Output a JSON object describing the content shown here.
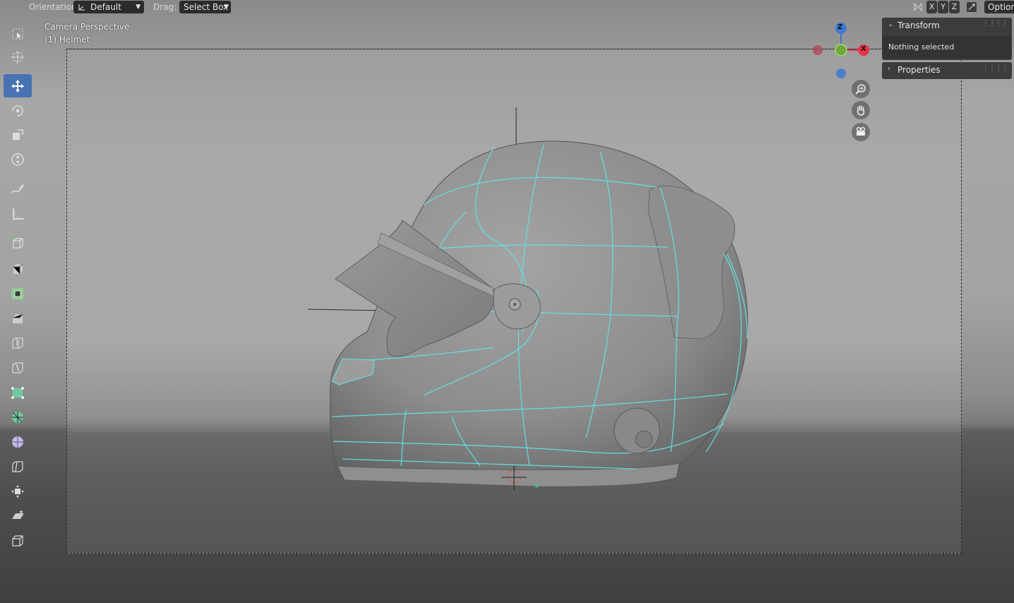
{
  "header": {
    "orientation_label": "Orientation:",
    "orientation_value": "Default",
    "drag_label": "Drag:",
    "drag_value": "Select Box",
    "axis_x": "X",
    "axis_y": "Y",
    "axis_z": "Z",
    "options_label": "Options"
  },
  "viewport": {
    "view_name": "Camera Perspective",
    "object_name": "(1) Helmet"
  },
  "gizmo": {
    "z_label": "Z",
    "x_label": "X",
    "colors": {
      "x": "#e8334a",
      "y": "#6fa73b",
      "z": "#3d79d1"
    }
  },
  "npanel": {
    "transform_title": "Transform",
    "transform_body": "Nothing selected",
    "properties_title": "Properties"
  },
  "toolbar": {
    "tools": [
      "select-box-tool",
      "cursor-tool",
      "move-tool",
      "rotate-tool",
      "scale-tool",
      "transform-tool",
      "annotate-tool",
      "measure-tool",
      "add-cube-tool",
      "extrude-region-tool",
      "inset-faces-tool",
      "bevel-tool",
      "loop-cut-tool",
      "knife-tool",
      "poly-build-tool",
      "spin-tool",
      "smooth-tool",
      "edge-slide-tool",
      "shrink-fatten-tool",
      "shear-tool",
      "rip-region-tool"
    ],
    "active_tool": "move-tool",
    "accent": "#4772b3"
  },
  "wire_color": "#5fe6e6"
}
